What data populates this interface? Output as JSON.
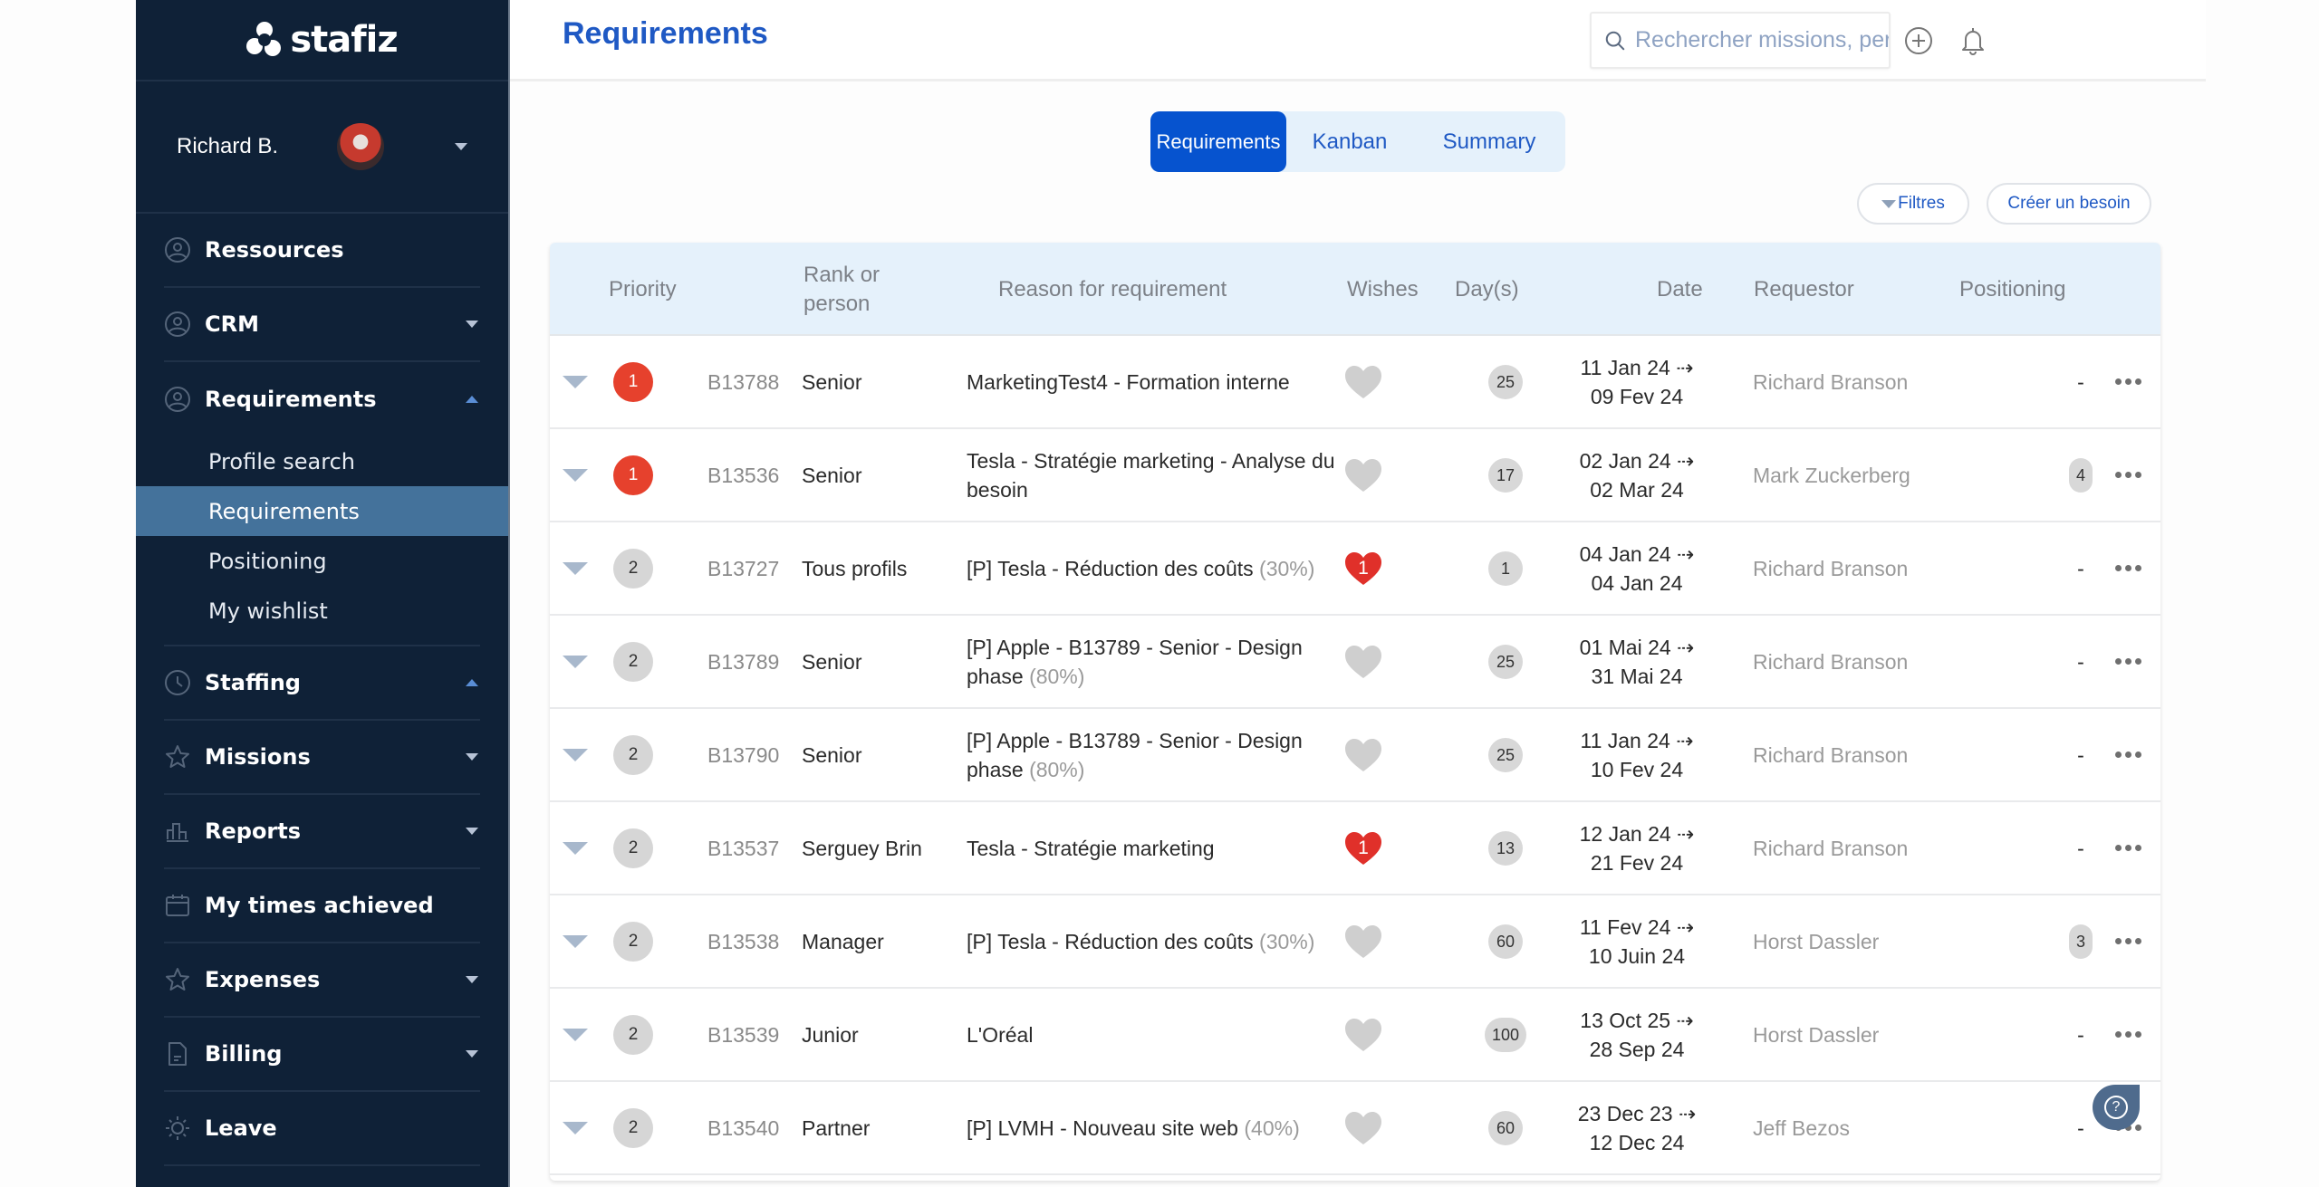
{
  "app": {
    "brand": "stafiz"
  },
  "user": {
    "name": "Richard B."
  },
  "sidebar": {
    "items": [
      {
        "label": "Ressources",
        "icon": "user-circle-icon",
        "caret": "none"
      },
      {
        "label": "CRM",
        "icon": "user-circle-icon",
        "caret": "down"
      },
      {
        "label": "Requirements",
        "icon": "user-circle-icon",
        "caret": "up"
      },
      {
        "label": "Staffing",
        "icon": "clock-icon",
        "caret": "up"
      },
      {
        "label": "Missions",
        "icon": "star-icon",
        "caret": "down"
      },
      {
        "label": "Reports",
        "icon": "bar-chart-icon",
        "caret": "down"
      },
      {
        "label": "My times achieved",
        "icon": "calendar-icon",
        "caret": "none"
      },
      {
        "label": "Expenses",
        "icon": "star-icon",
        "caret": "down"
      },
      {
        "label": "Billing",
        "icon": "document-icon",
        "caret": "down"
      },
      {
        "label": "Leave",
        "icon": "sun-icon",
        "caret": "none"
      }
    ],
    "requirements_sub": [
      {
        "label": "Profile search",
        "active": false
      },
      {
        "label": "Requirements",
        "active": true
      },
      {
        "label": "Positioning",
        "active": false
      },
      {
        "label": "My wishlist",
        "active": false
      }
    ]
  },
  "header": {
    "title": "Requirements",
    "search_placeholder": "Rechercher missions, personnes, factures"
  },
  "view_tabs": [
    {
      "label": "Requirements",
      "active": true
    },
    {
      "label": "Kanban",
      "active": false
    },
    {
      "label": "Summary",
      "active": false
    }
  ],
  "actions": {
    "filters": "Filtres",
    "create": "Créer un besoin"
  },
  "table": {
    "columns": [
      "Priority",
      "Rank or person",
      "Reason for requirement",
      "Wishes",
      "Day(s)",
      "Date",
      "Requestor",
      "Positioning"
    ],
    "rows": [
      {
        "priority": "1",
        "ref": "B13788",
        "rank": "Senior",
        "reason": "MarketingTest4 - Formation interne",
        "pct": "",
        "wishes": "",
        "wished": false,
        "days": "25",
        "date_from": "11 Jan 24 ⇢",
        "date_to": "09 Fev 24",
        "requestor": "Richard Branson",
        "positioning": "-"
      },
      {
        "priority": "1",
        "ref": "B13536",
        "rank": "Senior",
        "reason": "Tesla - Stratégie marketing - Analyse du besoin",
        "pct": "",
        "wishes": "",
        "wished": false,
        "days": "17",
        "date_from": "02 Jan 24 ⇢",
        "date_to": "02 Mar 24",
        "requestor": "Mark Zuckerberg",
        "positioning": "4"
      },
      {
        "priority": "2",
        "ref": "B13727",
        "rank": "Tous profils",
        "reason": "[P] Tesla - Réduction des coûts",
        "pct": "(30%)",
        "wishes": "1",
        "wished": true,
        "days": "1",
        "date_from": "04 Jan 24 ⇢",
        "date_to": "04 Jan 24",
        "requestor": "Richard Branson",
        "positioning": "-"
      },
      {
        "priority": "2",
        "ref": "B13789",
        "rank": "Senior",
        "reason": "[P] Apple - B13789 - Senior - Design phase",
        "pct": "(80%)",
        "wishes": "",
        "wished": false,
        "days": "25",
        "date_from": "01 Mai 24 ⇢",
        "date_to": "31 Mai 24",
        "requestor": "Richard Branson",
        "positioning": "-"
      },
      {
        "priority": "2",
        "ref": "B13790",
        "rank": "Senior",
        "reason": "[P] Apple - B13789 - Senior - Design phase",
        "pct": "(80%)",
        "wishes": "",
        "wished": false,
        "days": "25",
        "date_from": "11 Jan 24 ⇢",
        "date_to": "10 Fev 24",
        "requestor": "Richard Branson",
        "positioning": "-"
      },
      {
        "priority": "2",
        "ref": "B13537",
        "rank": "Serguey Brin",
        "reason": "Tesla - Stratégie marketing",
        "pct": "",
        "wishes": "1",
        "wished": true,
        "days": "13",
        "date_from": "12 Jan 24 ⇢",
        "date_to": "21 Fev 24",
        "requestor": "Richard Branson",
        "positioning": "-"
      },
      {
        "priority": "2",
        "ref": "B13538",
        "rank": "Manager",
        "reason": "[P] Tesla - Réduction des coûts",
        "pct": "(30%)",
        "wishes": "",
        "wished": false,
        "days": "60",
        "date_from": "11 Fev 24 ⇢",
        "date_to": "10 Juin 24",
        "requestor": "Horst Dassler",
        "positioning": "3"
      },
      {
        "priority": "2",
        "ref": "B13539",
        "rank": "Junior",
        "reason": "L'Oréal",
        "pct": "",
        "wishes": "",
        "wished": false,
        "days": "100",
        "date_from": "13 Oct 25 ⇢",
        "date_to": "28 Sep 24",
        "requestor": "Horst Dassler",
        "positioning": "-"
      },
      {
        "priority": "2",
        "ref": "B13540",
        "rank": "Partner",
        "reason": "[P] LVMH - Nouveau site web",
        "pct": "(40%)",
        "wishes": "",
        "wished": false,
        "days": "60",
        "date_from": "23 Dec 23 ⇢",
        "date_to": "12 Dec 24",
        "requestor": "Jeff Bezos",
        "positioning": "-"
      }
    ]
  },
  "help": {
    "icon": "question-icon"
  },
  "colors": {
    "sidebar_bg": "#0f2137",
    "active_sub": "#44729b",
    "accent": "#0653cf",
    "priority_high": "#e6412d",
    "wish_red": "#e0302a"
  }
}
